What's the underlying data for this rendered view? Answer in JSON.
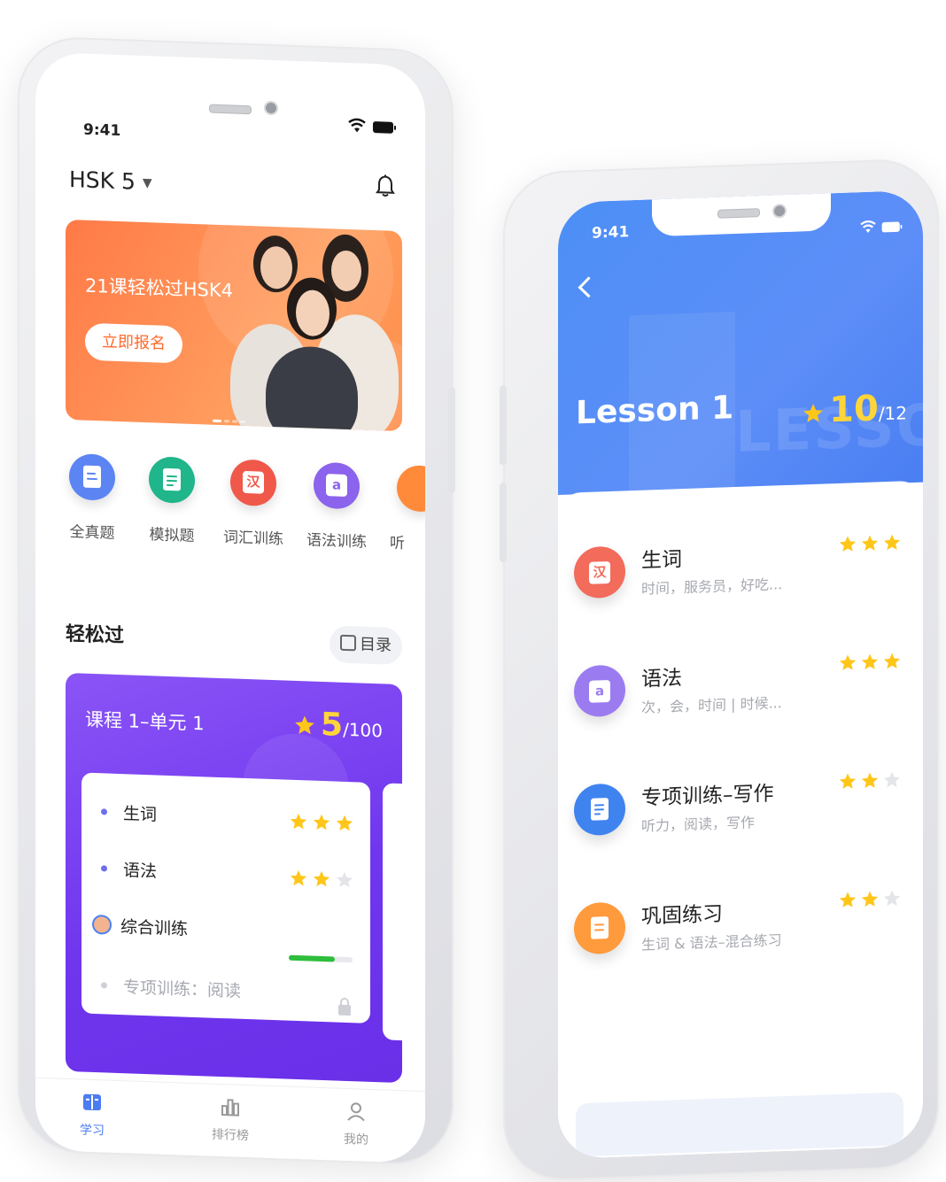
{
  "left_phone": {
    "status": {
      "time": "9:41"
    },
    "header": {
      "level": "HSK 5",
      "caret": "▼"
    },
    "banner": {
      "title": "21课轻松过HSK4",
      "button": "立即报名"
    },
    "quick_actions": [
      {
        "label": "全真题",
        "icon": "book-icon",
        "color": "#5c84f3"
      },
      {
        "label": "模拟题",
        "icon": "document-icon",
        "color": "#20b58a"
      },
      {
        "label": "词汇训练",
        "icon": "vocab-icon",
        "glyph": "汉",
        "color": "#f0584a"
      },
      {
        "label": "语法训练",
        "icon": "grammar-icon",
        "glyph": "a",
        "color": "#8b63ec"
      },
      {
        "label": "听",
        "icon": "listening-icon",
        "color": "#ff8a3a"
      }
    ],
    "section": {
      "title": "轻松过",
      "catalog": "目录"
    },
    "course": {
      "title": "课程 1–单元 1",
      "score": "5",
      "total": "/100",
      "rows": [
        {
          "label": "生词",
          "stars": 3
        },
        {
          "label": "语法",
          "stars": 2
        },
        {
          "label": "综合训练",
          "progress": 0.72
        },
        {
          "label": "专项训练：阅读",
          "locked": true
        }
      ]
    },
    "tabs": [
      {
        "label": "学习",
        "icon": "study-icon",
        "active": true
      },
      {
        "label": "排行榜",
        "icon": "ranking-icon"
      },
      {
        "label": "我的",
        "icon": "profile-icon"
      }
    ]
  },
  "right_phone": {
    "status": {
      "time": "9:41"
    },
    "lesson_title": "Lesson 1",
    "score": "10",
    "total": "/12",
    "items": [
      {
        "title": "生词",
        "sub": "时间，服务员，好吃...",
        "stars": 3,
        "icon": "vocab-icon",
        "glyph": "汉",
        "color": "#f26b5b"
      },
      {
        "title": "语法",
        "sub": "次，会，时间 | 时候...",
        "stars": 3,
        "icon": "grammar-icon",
        "glyph": "a",
        "color": "#9b7cf0"
      },
      {
        "title": "专项训练–写作",
        "sub": "听力，阅读，写作",
        "stars": 2,
        "icon": "writing-icon",
        "color": "#3f83ef"
      },
      {
        "title": "巩固练习",
        "sub": "生词 & 语法–混合练习",
        "stars": 2,
        "icon": "practice-icon",
        "color": "#ff9a3d"
      }
    ]
  },
  "colors": {
    "star_on": "#ffc61a",
    "star_off": "#e4e5e9",
    "accent_purple": "#7a3ff0",
    "accent_blue": "#4c8ff5"
  }
}
